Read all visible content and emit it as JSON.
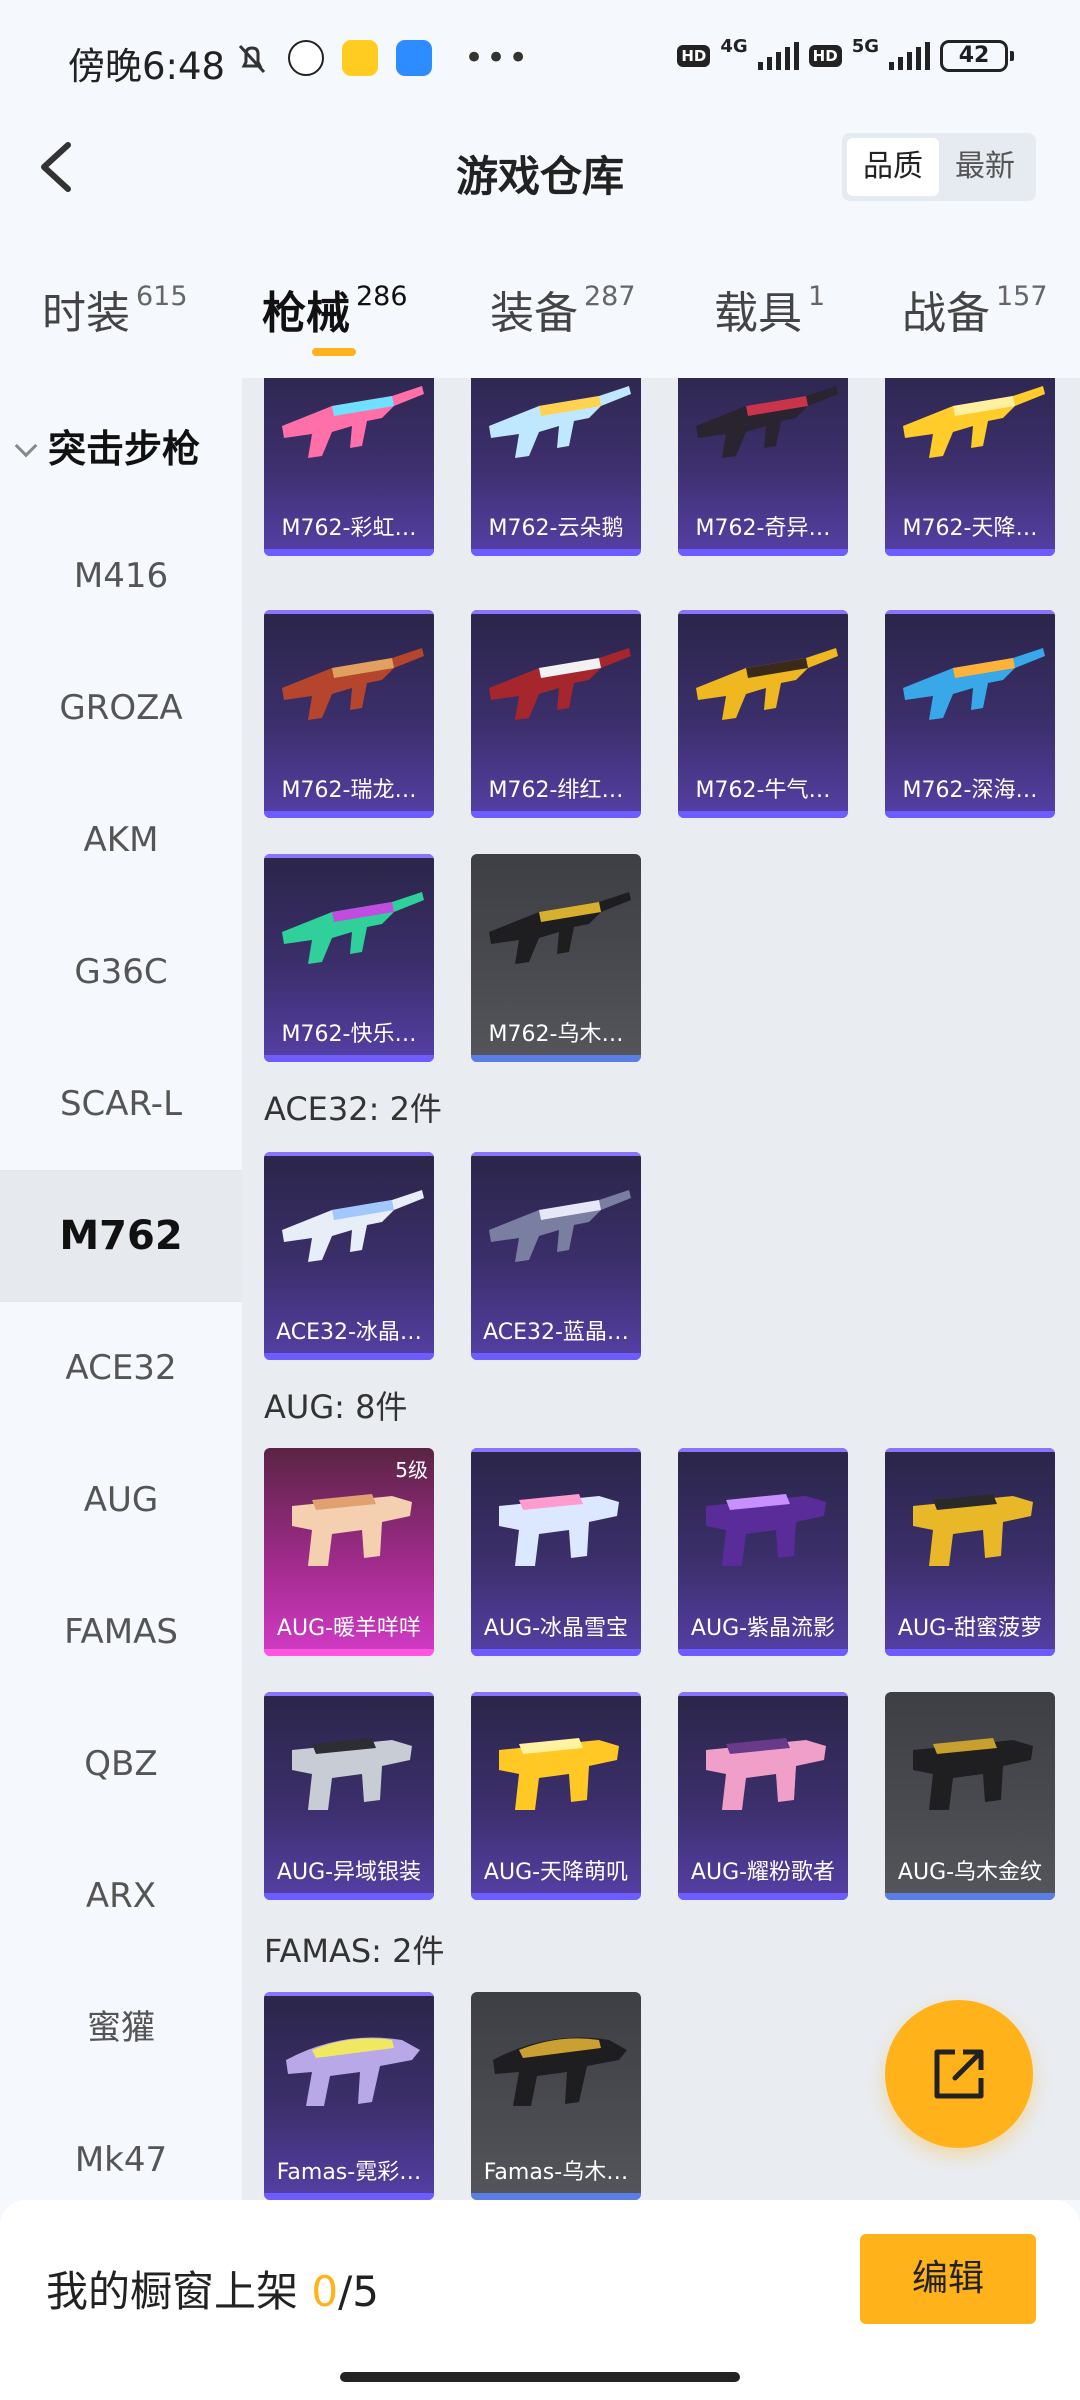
{
  "status": {
    "time": "傍晚6:48",
    "net1": "4G",
    "net2": "5G",
    "hd": "HD",
    "battery": "42"
  },
  "header": {
    "title": "游戏仓库",
    "sort_options": [
      "品质",
      "最新"
    ]
  },
  "tabs": [
    {
      "label": "时装",
      "count": "615"
    },
    {
      "label": "枪械",
      "count": "286"
    },
    {
      "label": "装备",
      "count": "287"
    },
    {
      "label": "载具",
      "count": "1"
    },
    {
      "label": "战备",
      "count": "157"
    }
  ],
  "sidebar": {
    "category": "突击步枪",
    "items": [
      "M416",
      "GROZA",
      "AKM",
      "G36C",
      "SCAR-L",
      "M762",
      "ACE32",
      "AUG",
      "FAMAS",
      "QBZ",
      "ARX",
      "蜜獾",
      "Mk47"
    ],
    "active": "M762"
  },
  "sections": {
    "ace32": "ACE32: 2件",
    "aug": "AUG: 8件",
    "famas": "FAMAS: 2件"
  },
  "cards": {
    "m762": [
      "M762-彩虹…",
      "M762-云朵鹅",
      "M762-奇异…",
      "M762-天降…",
      "M762-瑞龙…",
      "M762-绯红…",
      "M762-牛气…",
      "M762-深海…",
      "M762-快乐…",
      "M762-乌木…"
    ],
    "ace32": [
      "ACE32-冰晶…",
      "ACE32-蓝晶…"
    ],
    "aug": [
      "AUG-暖羊咩咩",
      "AUG-冰晶雪宝",
      "AUG-紫晶流影",
      "AUG-甜蜜菠萝",
      "AUG-异域银装",
      "AUG-天降萌叽",
      "AUG-耀粉歌者",
      "AUG-乌木金纹"
    ],
    "aug_level": "5级",
    "famas": [
      "Famas-霓彩…",
      "Famas-乌木…"
    ]
  },
  "bottom": {
    "label": "我的橱窗上架",
    "current": "0",
    "total": "/5",
    "edit": "编辑"
  },
  "colors": {
    "accent": "#ffb21a",
    "card_purple": "#3c2f6c",
    "card_grey": "#4a4b50",
    "card_pink": "#d23bc6"
  }
}
